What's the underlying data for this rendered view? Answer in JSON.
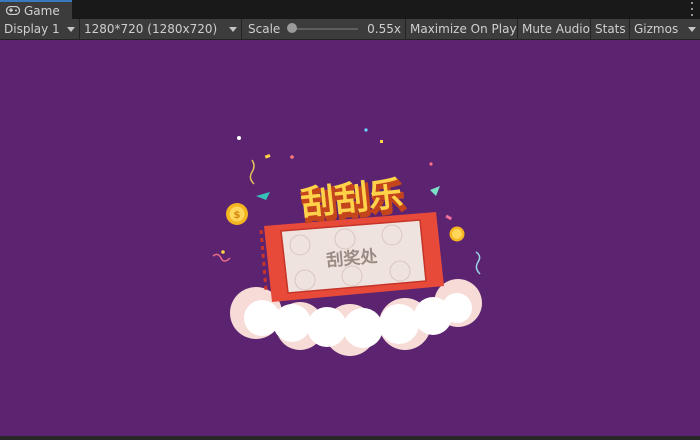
{
  "tab": {
    "label": "Game",
    "icon": "gamepad-icon"
  },
  "toolbar": {
    "display": "Display 1",
    "resolution": "1280*720 (1280x720)",
    "scale_label": "Scale",
    "scale_value_text": "0.55x",
    "scale_fraction": 0.05,
    "maximize_on_play": "Maximize On Play",
    "mute_audio": "Mute Audio",
    "stats": "Stats",
    "gizmos": "Gizmos"
  },
  "game": {
    "background": "#5c2470",
    "title_text": "刮刮乐",
    "ticket_text": "刮奖处",
    "title_color": "#ffd24a",
    "ticket_color": "#e84a3a",
    "panel_color": "#efe3df"
  }
}
